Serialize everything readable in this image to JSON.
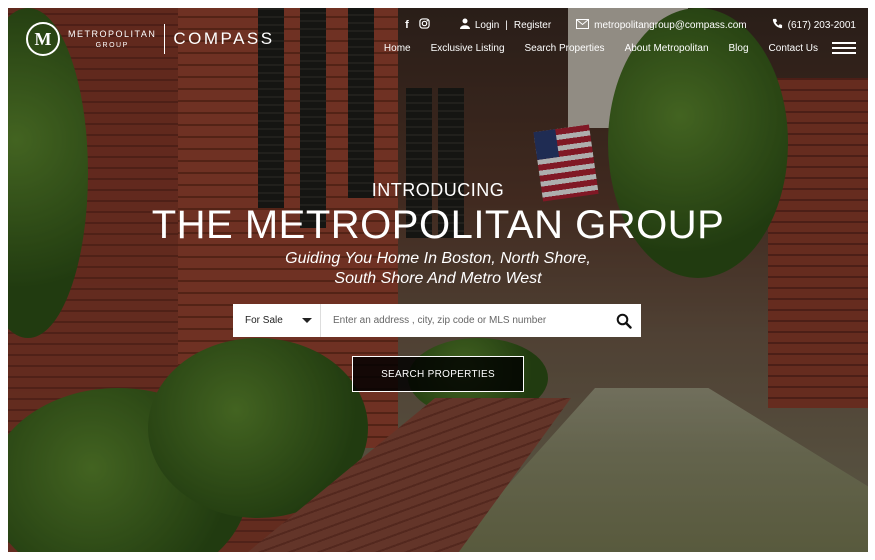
{
  "logo": {
    "mark": "M",
    "line1": "METROPOLITAN",
    "line2": "GROUP",
    "brand": "COMPASS"
  },
  "topbar": {
    "facebook_icon": "facebook-icon",
    "instagram_icon": "instagram-icon",
    "login": "Login",
    "separator": "|",
    "register": "Register",
    "email": "metropolitangroup@compass.com",
    "phone": "(617) 203-2001"
  },
  "nav": {
    "items": [
      {
        "label": "Home"
      },
      {
        "label": "Exclusive Listing"
      },
      {
        "label": "Search Properties"
      },
      {
        "label": "About Metropolitan"
      },
      {
        "label": "Blog"
      },
      {
        "label": "Contact Us"
      }
    ]
  },
  "hero": {
    "intro": "INTRODUCING",
    "title": "THE METROPOLITAN GROUP",
    "subtitle_line1": "Guiding You Home In Boston, North Shore,",
    "subtitle_line2": "South Shore And Metro West"
  },
  "search": {
    "type_selected": "For Sale",
    "placeholder": "Enter an address , city, zip code or MLS number",
    "button_label": "SEARCH PROPERTIES"
  },
  "colors": {
    "overlay": "#000000",
    "text": "#ffffff",
    "search_bg": "#ffffff"
  }
}
